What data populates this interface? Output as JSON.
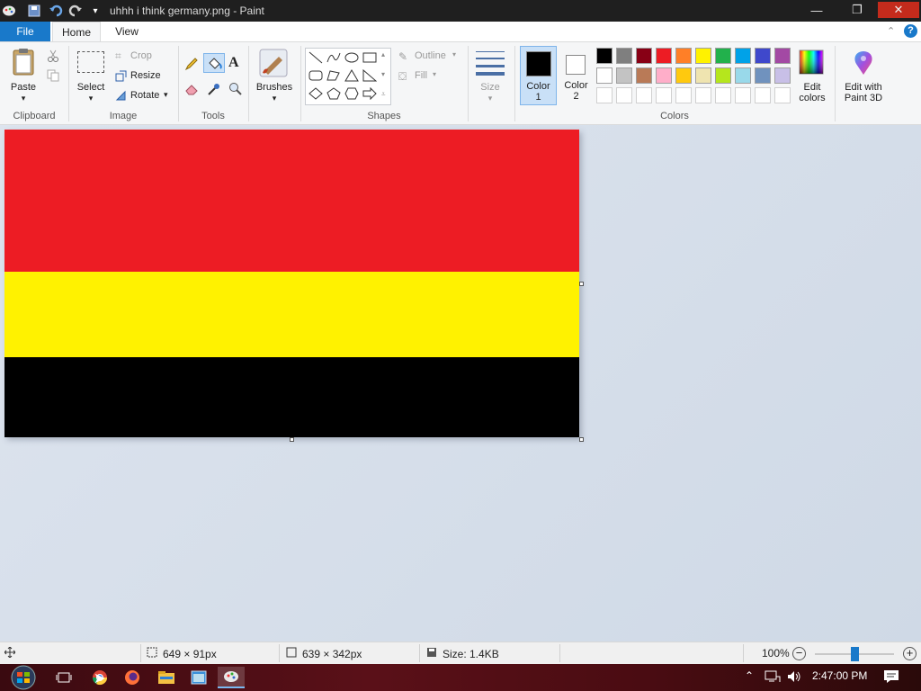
{
  "window": {
    "title": "uhhh i think germany.png - Paint",
    "minimize": "—",
    "maximize": "❐",
    "close": "✕"
  },
  "tabs": {
    "file": "File",
    "home": "Home",
    "view": "View"
  },
  "ribbon": {
    "clipboard": {
      "label": "Clipboard",
      "paste": "Paste"
    },
    "image": {
      "label": "Image",
      "select": "Select",
      "crop": "Crop",
      "resize": "Resize",
      "rotate": "Rotate"
    },
    "tools": {
      "label": "Tools"
    },
    "brushes": {
      "label": "Brushes"
    },
    "shapes": {
      "label": "Shapes",
      "outline": "Outline",
      "fill": "Fill"
    },
    "size": {
      "label": "Size"
    },
    "colors": {
      "label": "Colors",
      "color1": "Color",
      "color1_num": "1",
      "color2": "Color",
      "color2_num": "2",
      "edit_colors_1": "Edit",
      "edit_colors_2": "colors",
      "paint3d_1": "Edit with",
      "paint3d_2": "Paint 3D",
      "color1_value": "#000000",
      "color2_value": "#ffffff",
      "palette_row1": [
        "#000000",
        "#7f7f7f",
        "#880015",
        "#ed1c24",
        "#ff7f27",
        "#fff200",
        "#22b14c",
        "#00a2e8",
        "#3f48cc",
        "#a349a4"
      ],
      "palette_row2": [
        "#ffffff",
        "#c3c3c3",
        "#b97a57",
        "#ffaec9",
        "#ffc90e",
        "#efe4b0",
        "#b5e61d",
        "#99d9ea",
        "#7092be",
        "#c8bfe7"
      ]
    }
  },
  "canvas": {
    "stripes": [
      "#ed1c24",
      "#fff200",
      "#000000"
    ]
  },
  "status": {
    "cursor_pos": "649 × 91px",
    "selection_size": "639 × 342px",
    "file_size": "Size: 1.4KB",
    "zoom": "100%"
  },
  "taskbar": {
    "clock": "2:47:00 PM"
  }
}
